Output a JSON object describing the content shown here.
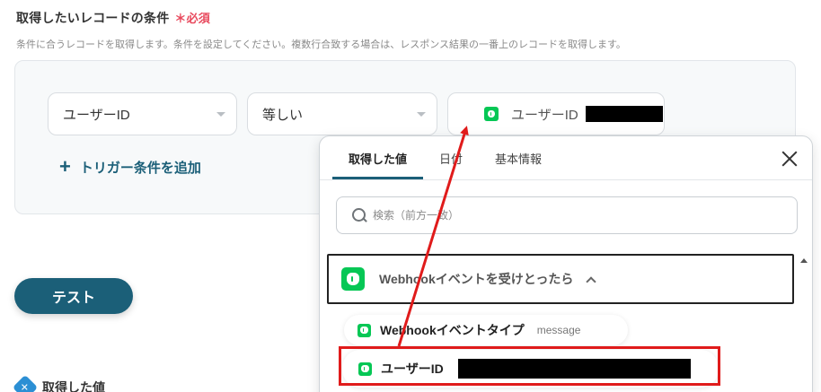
{
  "condition": {
    "title": "取得したいレコードの条件",
    "required_mark": "＊必須",
    "description": "条件に合うレコードを取得します。条件を設定してください。複数行合致する場合は、レスポンス結果の一番上のレコードを取得します。",
    "field_select": "ユーザーID",
    "operator_select": "等しい",
    "value_label": "ユーザーID",
    "add_trigger_label": "トリガー条件を追加"
  },
  "test_button_label": "テスト",
  "acquired_values_label": "取得した値",
  "popup": {
    "tabs": [
      "取得した値",
      "日付",
      "基本情報"
    ],
    "active_tab": 0,
    "search_placeholder": "検索（前方一致）",
    "group_title": "Webhookイベントを受けとったら",
    "items": [
      {
        "title": "Webhookイベントタイプ",
        "sample": "message"
      },
      {
        "title": "ユーザーID",
        "sample": ""
      }
    ]
  },
  "colors": {
    "brand": "#1b5f78",
    "line_green": "#06c755",
    "required_red": "#e8485c",
    "annotation_red": "#e01b1b"
  },
  "icons": [
    "line-app-icon",
    "plus-icon",
    "search-icon",
    "close-icon",
    "chevron-up-icon",
    "scroll-up-icon",
    "gear-icon"
  ]
}
